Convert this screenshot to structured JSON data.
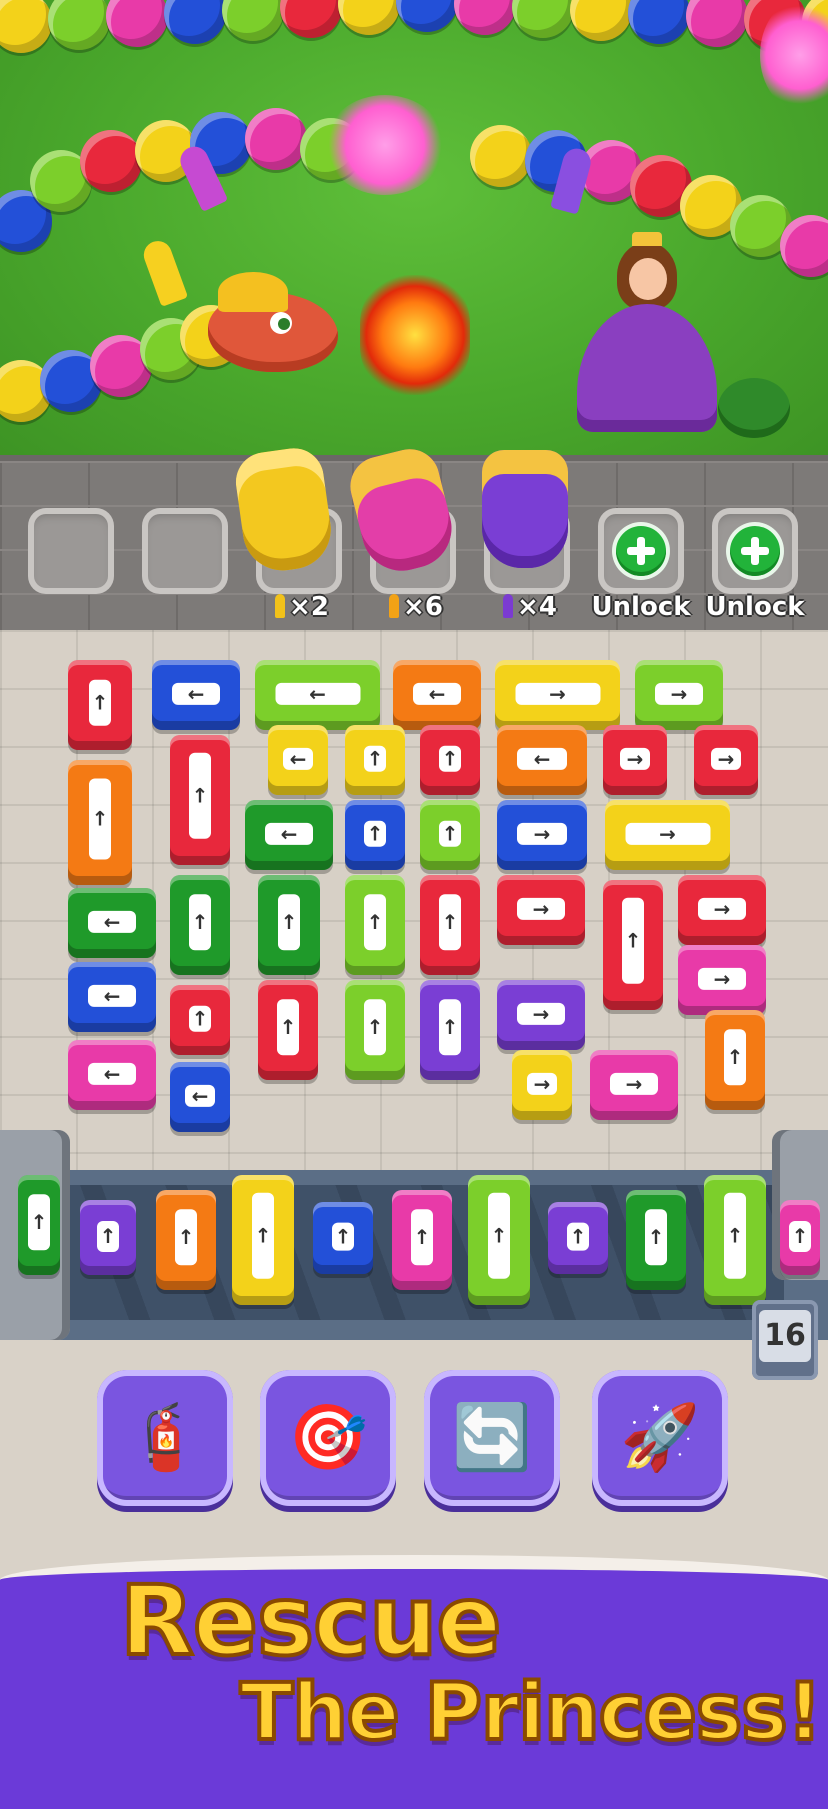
{
  "slots": {
    "ammo": [
      {
        "count": "×2",
        "color": "#f2c21a"
      },
      {
        "count": "×6",
        "color": "#f2a216"
      },
      {
        "count": "×4",
        "color": "#7b3bd1"
      }
    ],
    "unlock_labels": [
      "Unlock",
      "Unlock"
    ]
  },
  "level": "16",
  "boosters": [
    {
      "name": "add-cannon-booster",
      "icon": "cannon-plus-icon"
    },
    {
      "name": "target-booster",
      "icon": "target-icon"
    },
    {
      "name": "shuffle-booster",
      "icon": "shuffle-icon"
    },
    {
      "name": "rocket-booster",
      "icon": "rocket-icon"
    }
  ],
  "banner": {
    "line1": "Rescue",
    "line2": "The Princess!"
  },
  "colors": {
    "red": "#e8283c",
    "blue": "#2350d8",
    "green": "#1f9a2a",
    "lime": "#7ccf2b",
    "yellow": "#f3d21a",
    "orange": "#f47a14",
    "purple": "#7a3ed4",
    "pink": "#e83aa8"
  }
}
